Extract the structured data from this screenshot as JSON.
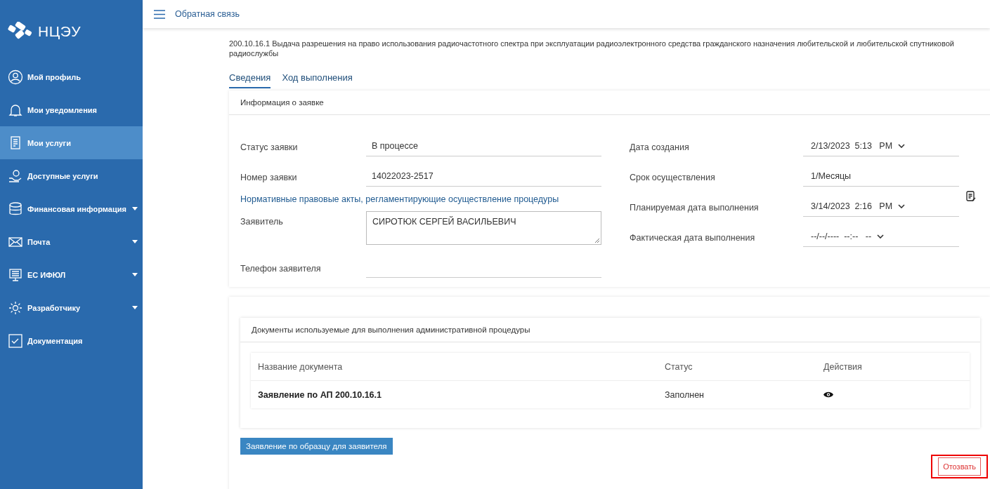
{
  "logo": {
    "text": "НЦЭУ"
  },
  "sidebar": {
    "items": [
      {
        "label": "Мой профиль",
        "kind": "link",
        "selected": false
      },
      {
        "label": "Мои уведомления",
        "kind": "link",
        "selected": false
      },
      {
        "label": "Мои услуги",
        "kind": "link",
        "selected": true
      },
      {
        "label": "Доступные услуги",
        "kind": "link",
        "selected": false
      },
      {
        "label": "Финансовая информация",
        "kind": "group",
        "selected": false
      },
      {
        "label": "Почта",
        "kind": "group",
        "selected": false
      },
      {
        "label": "ЕС ИФЮЛ",
        "kind": "group",
        "selected": false
      },
      {
        "label": "Разработчику",
        "kind": "group",
        "selected": false
      },
      {
        "label": "Документация",
        "kind": "link",
        "selected": false
      }
    ]
  },
  "header": {
    "link": "Обратная связь"
  },
  "page_title": "200.10.16.1 Выдача разрешения на право использования радиочастотного спектра при эксплуатации радиоэлектронного средства гражданского назначения любительской и любительской спутниковой радиослужбы",
  "tabs": [
    {
      "label": "Сведения",
      "selected": true
    },
    {
      "label": "Ход выполнения",
      "selected": false
    }
  ],
  "info_card": {
    "title": "Информация о заявке",
    "left_fields": [
      {
        "kind": "line",
        "label": "Статус заявки",
        "value": "В процессе"
      },
      {
        "kind": "line",
        "label": "Номер заявки",
        "value": "14022023-2517"
      },
      {
        "kind": "link",
        "label": "Нормативные правовые акты, регламентирующие осуществление процедуры"
      },
      {
        "kind": "textarea",
        "label": "Заявитель",
        "value": "СИРОТЮК СЕРГЕЙ ВАСИЛЬЕВИЧ"
      },
      {
        "kind": "line",
        "label": "Телефон заявителя"
      }
    ],
    "right_fields": [
      {
        "kind": "datetime",
        "label": "Дата создания",
        "value": "2/13/2023  5:13   PM"
      },
      {
        "kind": "line",
        "label": "Срок осуществления",
        "value": "1/Месяцы"
      },
      {
        "kind": "datetime",
        "label": "Планируемая дата выполнения",
        "value": "3/14/2023  2:16   PM"
      },
      {
        "kind": "datetime",
        "label": "Фактическая дата выполнения",
        "value": "--/--/----  --:--   --"
      }
    ]
  },
  "documents_card": {
    "title": "Документы используемые для выполнения административной процедуры",
    "columns": [
      "Название документа",
      "Статус",
      "Действия"
    ],
    "rows": [
      {
        "name": "Заявление по АП 200.10.16.1",
        "status": "Заполнен"
      }
    ]
  },
  "sample_button": "Заявление по образцу для заявителя",
  "revoke_button": "Отозвать"
}
